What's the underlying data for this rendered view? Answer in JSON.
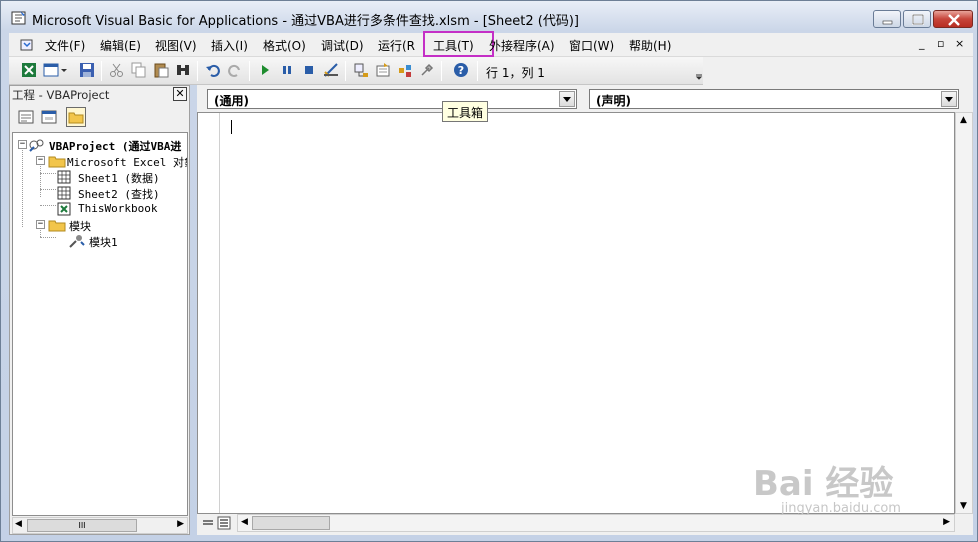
{
  "window": {
    "title": "Microsoft Visual Basic for Applications - 通过VBA进行多条件查找.xlsm - [Sheet2 (代码)]"
  },
  "menubar": {
    "items": [
      {
        "label": "文件(F)"
      },
      {
        "label": "编辑(E)"
      },
      {
        "label": "视图(V)"
      },
      {
        "label": "插入(I)"
      },
      {
        "label": "格式(O)"
      },
      {
        "label": "调试(D)"
      },
      {
        "label": "运行(R"
      },
      {
        "label": "工具(T)"
      },
      {
        "label": "外接程序(A)"
      },
      {
        "label": "窗口(W)"
      },
      {
        "label": "帮助(H)"
      }
    ],
    "highlighted": "工具(T)",
    "highlight_color": "#c42fc6",
    "mdi_controls": [
      "_",
      "▫",
      "×"
    ]
  },
  "toolbar": {
    "position_status": "行 1，列 1",
    "icons": [
      "excel-icon",
      "insert-userform-icon",
      "save-icon",
      "cut-icon",
      "copy-icon",
      "paste-icon",
      "find-icon",
      "undo-icon",
      "redo-icon",
      "run-icon",
      "break-icon",
      "reset-icon",
      "design-mode-icon",
      "project-explorer-icon",
      "properties-icon",
      "object-browser-icon",
      "toolbox-icon",
      "help-icon"
    ]
  },
  "tooltip": {
    "text": "工具箱"
  },
  "project_pane": {
    "title": "工程 - VBAProject",
    "tree": [
      {
        "label": "VBAProject (通过VBA进",
        "level": 0,
        "expander": "−",
        "icon": "vbaproject-icon"
      },
      {
        "label": "Microsoft Excel 对象",
        "level": 1,
        "expander": "−",
        "icon": "folder-icon"
      },
      {
        "label": "Sheet1 (数据)",
        "level": 2,
        "icon": "sheet-icon"
      },
      {
        "label": "Sheet2 (查找)",
        "level": 2,
        "icon": "sheet-icon"
      },
      {
        "label": "ThisWorkbook",
        "level": 2,
        "icon": "workbook-icon"
      },
      {
        "label": "模块",
        "level": 1,
        "expander": "−",
        "icon": "folder-icon"
      },
      {
        "label": "模块1",
        "level": 2,
        "icon": "module-icon"
      }
    ],
    "hscroll_thumb": "III"
  },
  "code_window": {
    "object_combo": "(通用)",
    "procedure_combo": "(声明)",
    "content": ""
  },
  "watermark": {
    "main": "Bai 经验",
    "sub": "jingyan.baidu.com"
  }
}
